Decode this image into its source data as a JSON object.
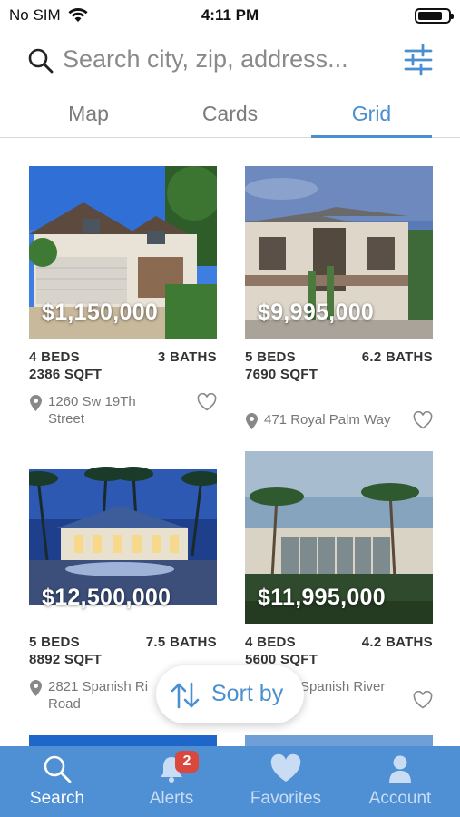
{
  "status_bar": {
    "carrier": "No SIM",
    "time": "4:11 PM",
    "battery_level": 0.7
  },
  "search": {
    "placeholder": "Search city, zip, address..."
  },
  "view_tabs": [
    {
      "label": "Map",
      "active": false
    },
    {
      "label": "Cards",
      "active": false
    },
    {
      "label": "Grid",
      "active": true
    }
  ],
  "listings": [
    {
      "price": "$1,150,000",
      "beds": "4 BEDS",
      "baths": "3 BATHS",
      "sqft": "2386 SQFT",
      "address_line1": "1260 Sw 19Th",
      "address_line2": "Street"
    },
    {
      "price": "$9,995,000",
      "beds": "5 BEDS",
      "baths": "6.2 BATHS",
      "sqft": "7690 SQFT",
      "address_line1": "471 Royal Palm Way",
      "address_line2": ""
    },
    {
      "price": "$12,500,000",
      "beds": "5 BEDS",
      "baths": "7.5 BATHS",
      "sqft": "8892 SQFT",
      "address_line1": "2821 Spanish Ri",
      "address_line2": "Road"
    },
    {
      "price": "$11,995,000",
      "beds": "4 BEDS",
      "baths": "4.2 BATHS",
      "sqft": "5600 SQFT",
      "address_line1": "Spanish River",
      "address_line2": ""
    }
  ],
  "sort": {
    "label": "Sort by"
  },
  "tabbar": [
    {
      "label": "Search",
      "icon": "search-icon",
      "active": true
    },
    {
      "label": "Alerts",
      "icon": "bell-icon",
      "badge": "2",
      "active": false
    },
    {
      "label": "Favorites",
      "icon": "heart-icon",
      "active": false
    },
    {
      "label": "Account",
      "icon": "person-icon",
      "active": false
    }
  ],
  "colors": {
    "accent": "#4a8fcf",
    "tabbar": "#4f8fd4",
    "badge": "#d9473d"
  }
}
